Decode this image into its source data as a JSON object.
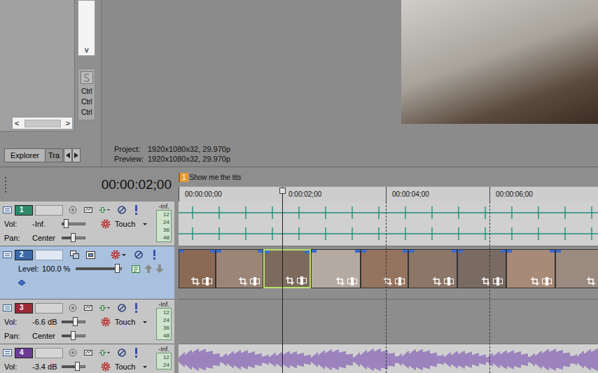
{
  "explorer": {
    "scroll": {
      "down": "v",
      "left": "<",
      "right": ">"
    },
    "shortcuts": [
      "Ctrl",
      "Ctrl",
      "Ctrl"
    ],
    "tabs": [
      {
        "label": "Explorer",
        "selected": true
      },
      {
        "label": "Tra",
        "selected": false
      }
    ]
  },
  "preview": {
    "info": [
      {
        "label": "Project:",
        "value": "1920x1080x32, 29.970p"
      },
      {
        "label": "Preview:",
        "value": "1920x1080x32, 29.970p"
      }
    ]
  },
  "timeline": {
    "time": "00:00:02;00",
    "markers": [
      {
        "number": "1",
        "label": "Show me the tits"
      }
    ],
    "ruler": [
      "00:00:00;00",
      "0:00:02;00",
      "00:00:04;00",
      "00:00:06;00"
    ]
  },
  "tracks": [
    {
      "number": "1",
      "kind": "audio",
      "color": "#2f8a6c",
      "selected": false,
      "vol_label": "Vol:",
      "vol": "-Inf.",
      "vol_level": 0.2,
      "pan_label": "Pan:",
      "pan": "Center",
      "pan_level": 0.5,
      "automation": "Touch",
      "meter": "-Inf.",
      "meter_scale": [
        "12",
        "24",
        "36",
        "48"
      ],
      "wave_color": "#1f8f7c"
    },
    {
      "number": "2",
      "kind": "video",
      "color": "#3c6aa8",
      "selected": true,
      "level_label": "Level:",
      "level_reading": "100.0 %",
      "level": 0.92,
      "clips": [
        {
          "selected": false
        },
        {
          "selected": false
        },
        {
          "selected": true
        },
        {
          "selected": false
        },
        {
          "selected": false
        },
        {
          "selected": false
        },
        {
          "selected": false
        },
        {
          "selected": false
        },
        {
          "selected": false
        }
      ]
    },
    {
      "number": "3",
      "kind": "audio",
      "color": "#9c2a36",
      "selected": false,
      "vol_label": "Vol:",
      "vol": "-6.6 dB",
      "vol_level": 0.6,
      "pan_label": "Pan:",
      "pan": "Center",
      "pan_level": 0.5,
      "automation": "Touch",
      "meter": "-Inf.",
      "meter_scale": [
        "12",
        "24",
        "36",
        "48"
      ]
    },
    {
      "number": "4",
      "kind": "audio",
      "color": "#6b3c93",
      "selected": false,
      "vol_label": "Vol:",
      "vol": "-3.4 dB",
      "vol_level": 0.68,
      "automation": "Touch",
      "meter": "-Inf.",
      "meter_scale": [
        "12",
        "24"
      ],
      "wave_color": "#7a4fb0"
    }
  ]
}
